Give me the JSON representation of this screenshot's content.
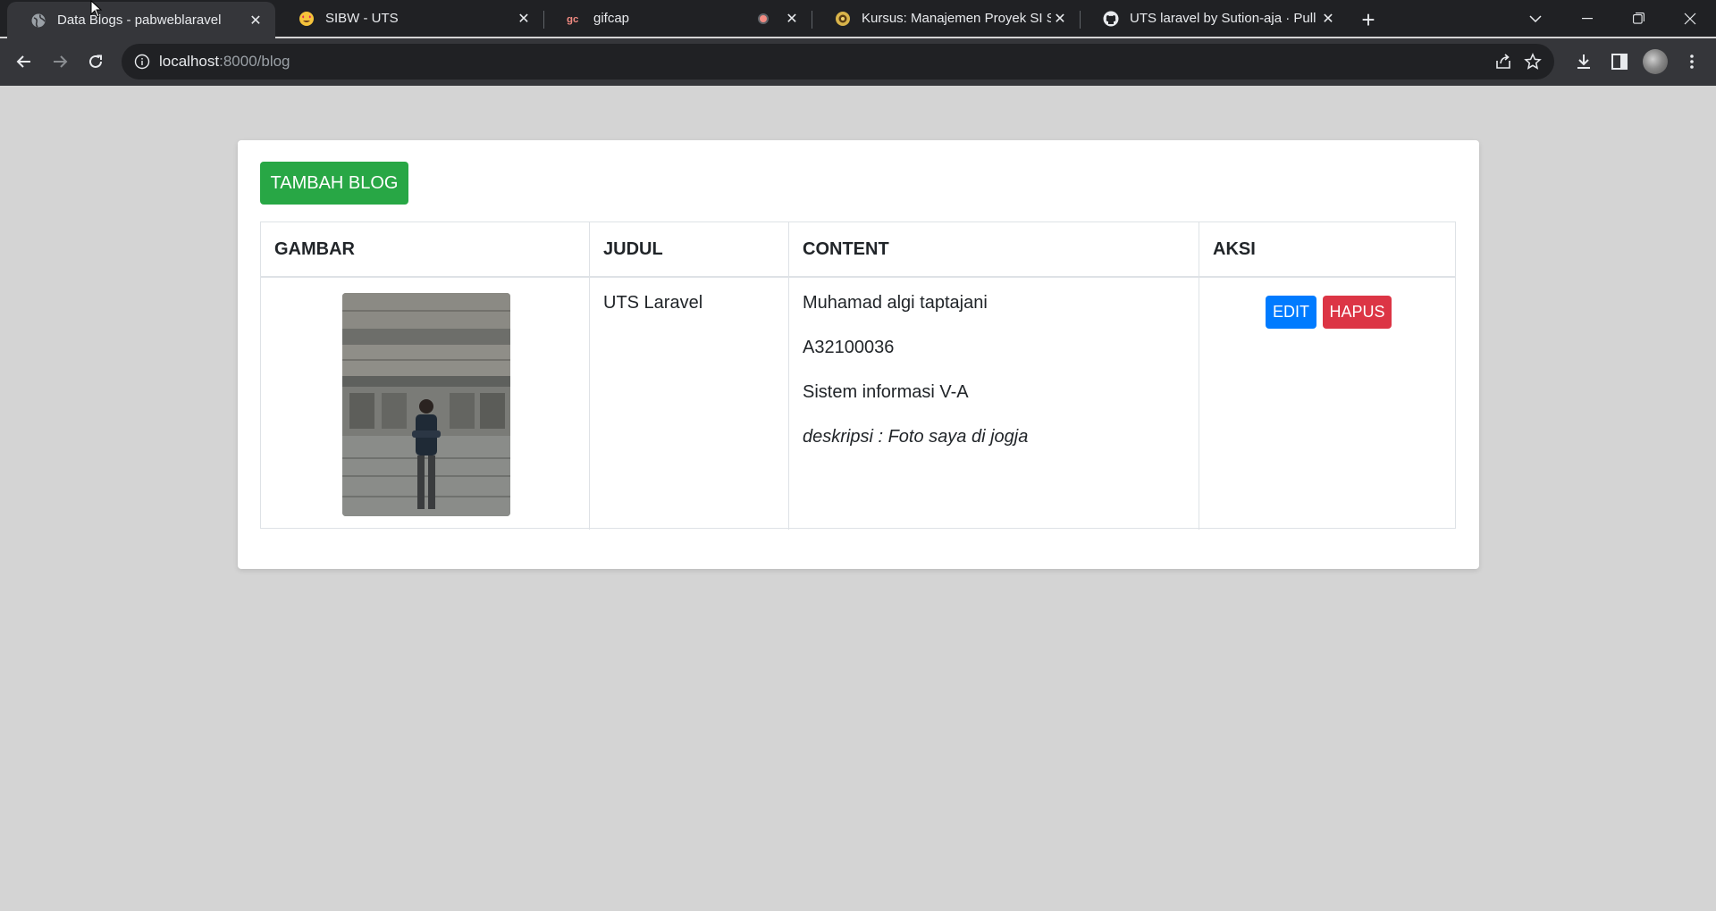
{
  "browser": {
    "tabs": [
      {
        "title": "Data Blogs - pabweblaravel",
        "icon": "globe-icon",
        "active": true
      },
      {
        "title": "SIBW - UTS",
        "icon": "star-struck-emoji-icon",
        "active": false
      },
      {
        "title": "gifcap",
        "icon": "gifcap-logo-icon",
        "active": false,
        "recording": true
      },
      {
        "title": "Kursus: Manajemen Proyek SI SI",
        "icon": "university-logo-icon",
        "active": false
      },
      {
        "title": "UTS laravel by Sution-aja · Pull R",
        "icon": "github-icon",
        "active": false
      }
    ],
    "new_tab_label": "+",
    "url_host": "localhost",
    "url_rest": ":8000/blog",
    "colors": {
      "tabbar": "#202124",
      "toolbar": "#35363a",
      "omnibox": "#202124"
    }
  },
  "page": {
    "add_button": "TAMBAH BLOG",
    "table": {
      "headers": [
        "GAMBAR",
        "JUDUL",
        "CONTENT",
        "AKSI"
      ],
      "rows": [
        {
          "judul": "UTS Laravel",
          "content": [
            "Muhamad algi taptajani",
            "A32100036",
            "Sistem informasi V-A"
          ],
          "content_italic": "deskripsi : Foto saya di jogja",
          "edit_label": "EDIT",
          "delete_label": "HAPUS"
        }
      ]
    },
    "colors": {
      "background": "#d4d4d4",
      "add": "#28a745",
      "edit": "#007bff",
      "delete": "#dc3545"
    }
  }
}
